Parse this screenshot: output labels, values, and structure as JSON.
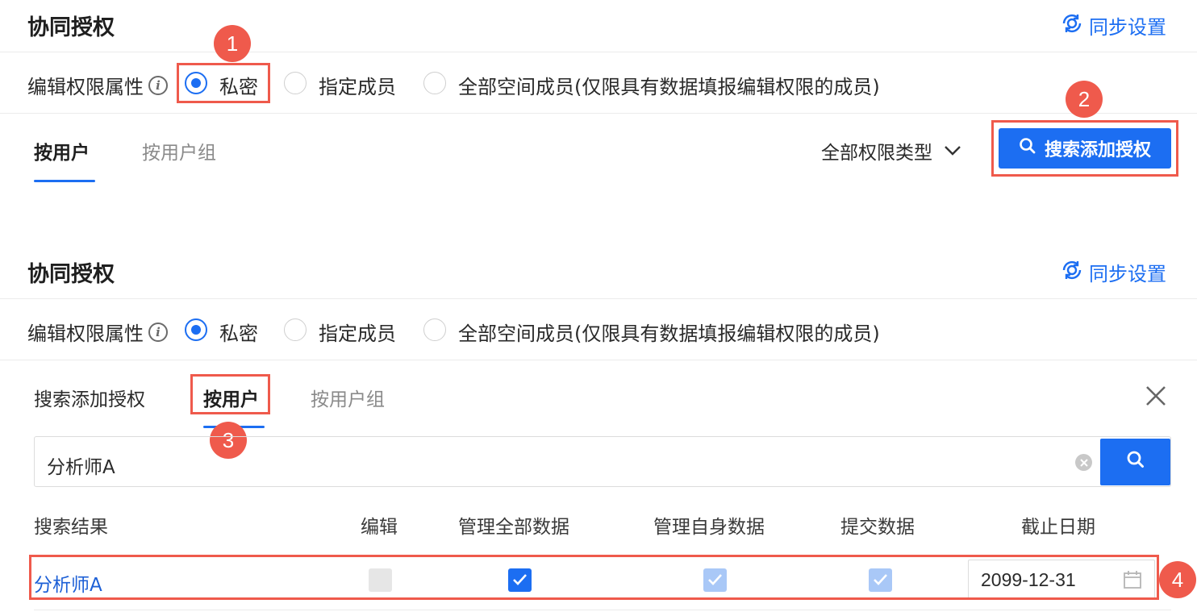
{
  "section_title": "协同授权",
  "sync_label": "同步设置",
  "edit_attr_label": "编辑权限属性",
  "radio_options": [
    "私密",
    "指定成员",
    "全部空间成员(仅限具有数据填报编辑权限的成员)"
  ],
  "top_tabs": [
    "按用户",
    "按用户组"
  ],
  "permission_filter": "全部权限类型",
  "search_add_button": "搜索添加授权",
  "search_panel": {
    "title": "搜索添加授权",
    "tabs": [
      "按用户",
      "按用户组"
    ],
    "search_value": "分析师A"
  },
  "table": {
    "headers": [
      "搜索结果",
      "编辑",
      "管理全部数据",
      "管理自身数据",
      "提交数据",
      "截止日期"
    ],
    "rows": [
      {
        "name": "分析师A",
        "edit": "disabled",
        "manage_all": "checked",
        "manage_self": "checked-disabled",
        "submit": "checked-disabled",
        "deadline": "2099-12-31"
      }
    ]
  },
  "badges": [
    "1",
    "2",
    "3",
    "4"
  ],
  "colors": {
    "accent": "#1c6ef2",
    "annotation": "#ef5a4c"
  },
  "icons": [
    "info-icon",
    "sync-icon",
    "chevron-down-icon",
    "search-icon",
    "close-icon",
    "clear-icon",
    "calendar-icon",
    "check-icon"
  ]
}
